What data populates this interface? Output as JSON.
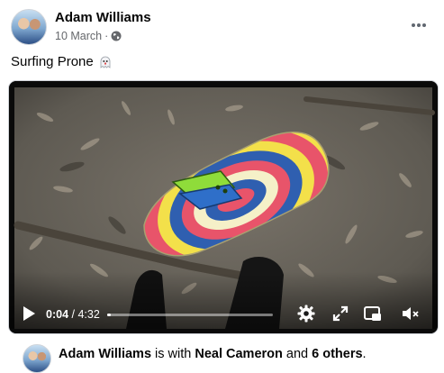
{
  "post": {
    "author": "Adam Williams",
    "date": "10 March",
    "separator": "·",
    "privacy_icon": "globe-icon",
    "more_icon": "more-options-icon",
    "text": "Surfing Prone",
    "emoji_icon": "ghost-emoji-icon"
  },
  "video": {
    "current_time": "0:04",
    "time_separator": " / ",
    "duration": "4:32",
    "progress_fraction": 0.015,
    "icons": [
      "play-icon",
      "settings-gear-icon",
      "fullscreen-icon",
      "picture-in-picture-icon",
      "volume-muted-icon"
    ]
  },
  "footer": {
    "name": "Adam Williams",
    "with_text": " is with ",
    "tagged_name": "Neal Cameron",
    "and_text": " and ",
    "others": "6 others",
    "end": "."
  },
  "colors": {
    "text_primary": "#050505",
    "text_secondary": "#65676b",
    "mat_red": "#e8546a",
    "mat_yellow": "#f3e04a",
    "mat_blue": "#2f5fb0",
    "fins_green": "#8fdc3a",
    "ground": "#6f6a60"
  }
}
